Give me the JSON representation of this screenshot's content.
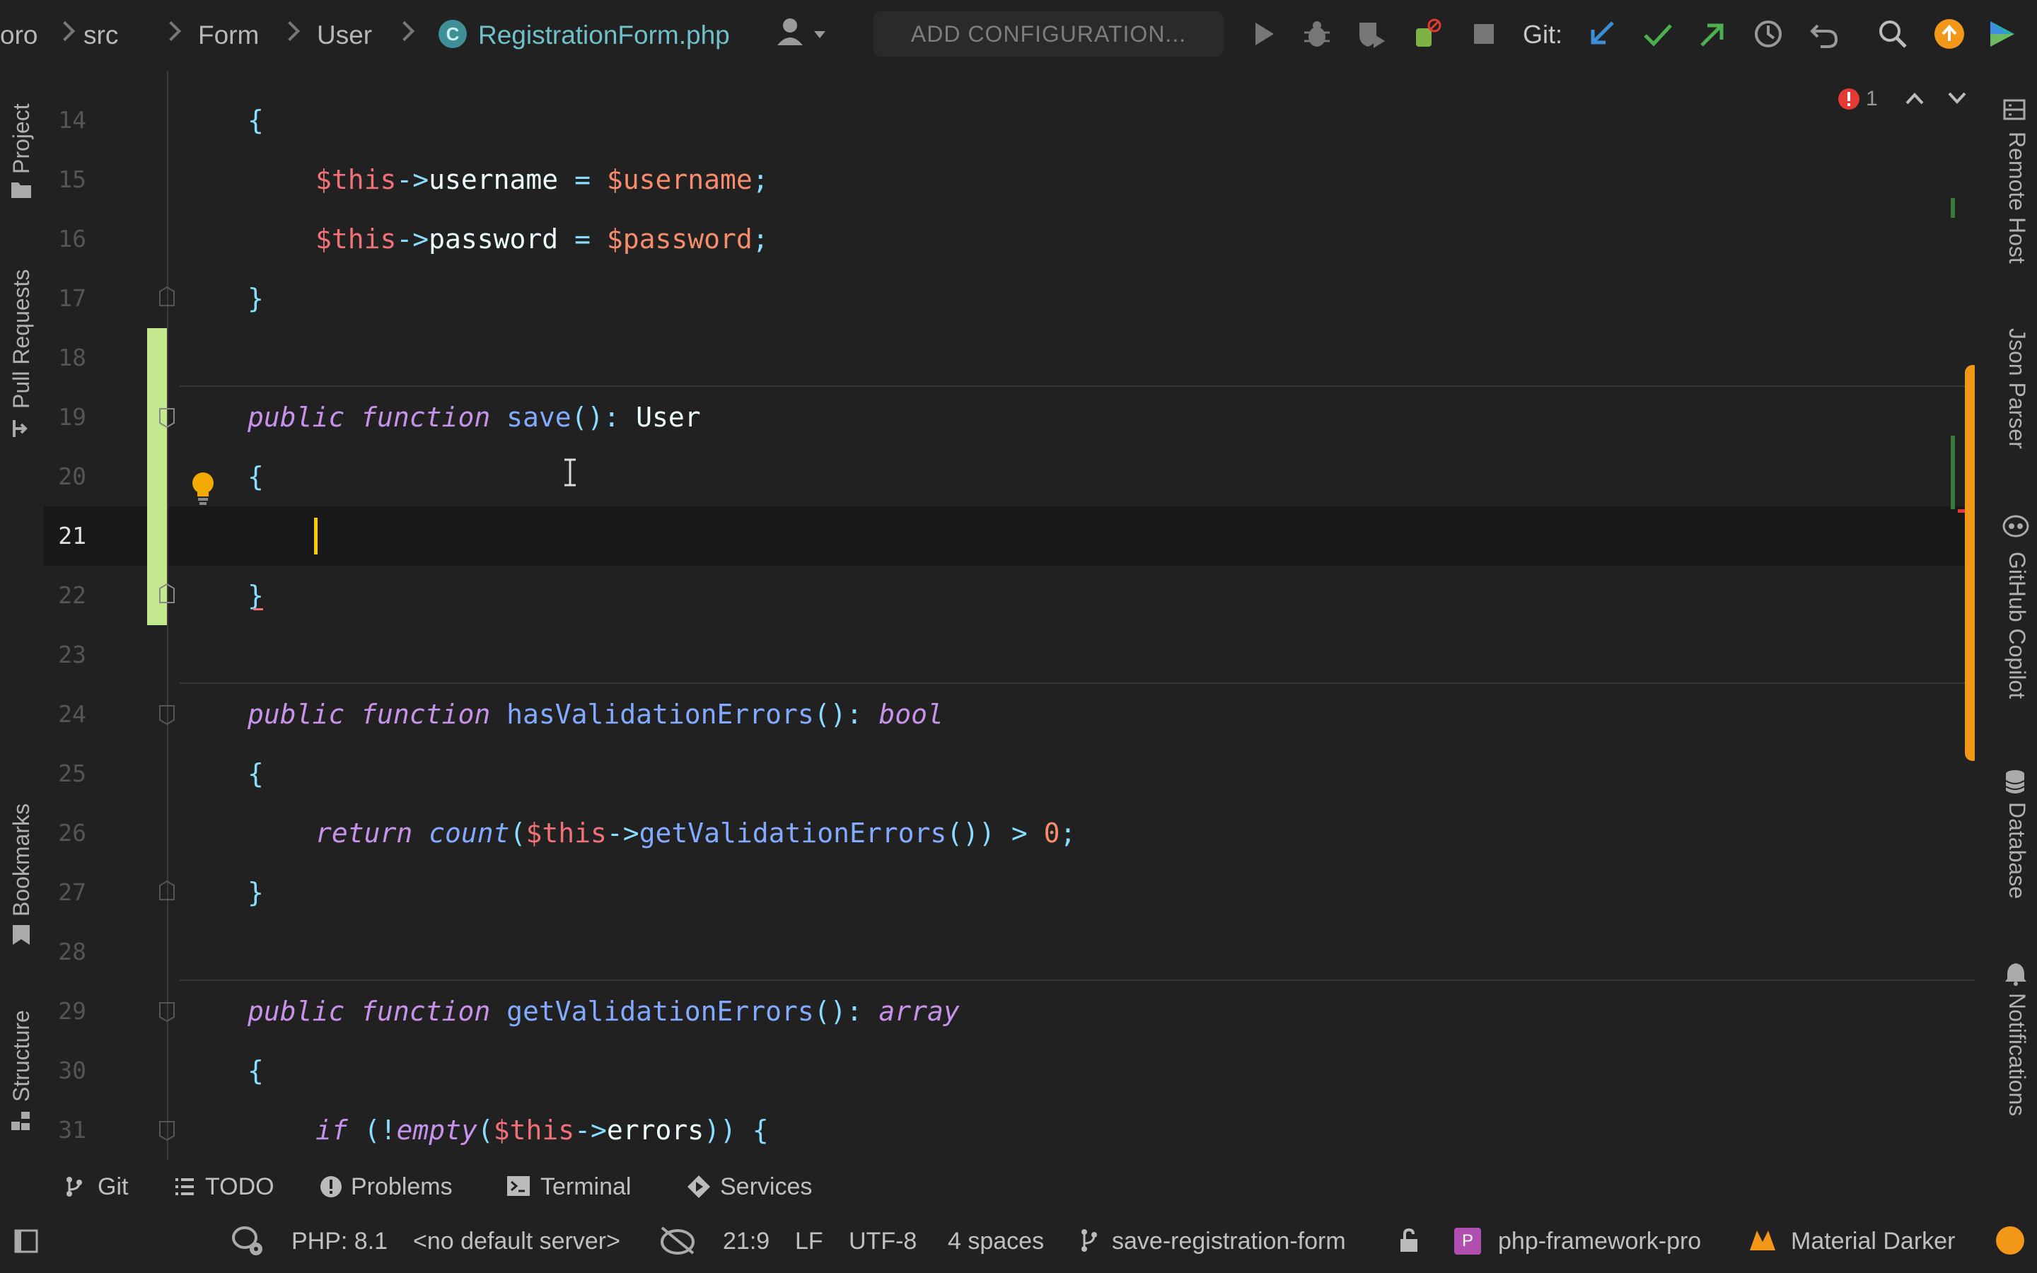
{
  "breadcrumbs": {
    "project_partial": "oro",
    "items": [
      "src",
      "Form",
      "User"
    ],
    "file": "RegistrationForm.php",
    "file_icon_letter": "C"
  },
  "toolbar": {
    "add_configuration": "ADD CONFIGURATION...",
    "git_label": "Git:",
    "icons": [
      "user-icon",
      "run-icon",
      "debug-icon",
      "coverage-icon",
      "profile-icon",
      "stop-icon",
      "git-update-icon",
      "git-commit-icon",
      "git-push-icon",
      "history-icon",
      "rollback-icon",
      "search-icon",
      "update-available-icon",
      "toolbox-icon"
    ]
  },
  "left_tools": [
    "Project",
    "Pull Requests",
    "Bookmarks",
    "Structure"
  ],
  "right_tools": [
    "Remote Host",
    "Json Parser",
    "GitHub Copilot",
    "Database",
    "Notifications"
  ],
  "inspection": {
    "error_count": "1"
  },
  "editor": {
    "current_line": 21,
    "lines": [
      {
        "n": "14"
      },
      {
        "n": "15"
      },
      {
        "n": "16"
      },
      {
        "n": "17"
      },
      {
        "n": "18"
      },
      {
        "n": "19"
      },
      {
        "n": "20"
      },
      {
        "n": "21"
      },
      {
        "n": "22"
      },
      {
        "n": "23"
      },
      {
        "n": "24"
      },
      {
        "n": "25"
      },
      {
        "n": "26"
      },
      {
        "n": "27"
      },
      {
        "n": "28"
      },
      {
        "n": "29"
      },
      {
        "n": "30"
      },
      {
        "n": "31"
      }
    ],
    "tokens": {
      "this": "$this",
      "arrow": "->",
      "username": "username",
      "username_var": "$username",
      "password": "password",
      "password_var": "$password",
      "public": "public",
      "function": "function",
      "save": "save",
      "user_type": "User",
      "hasValidationErrors": "hasValidationErrors",
      "bool": "bool",
      "return": "return",
      "count": "count",
      "getValidationErrors": "getValidationErrors",
      "zero": "0",
      "array": "array",
      "if": "if",
      "empty": "empty",
      "errors": "errors"
    }
  },
  "bottom_tabs": [
    "Git",
    "TODO",
    "Problems",
    "Terminal",
    "Services"
  ],
  "status_bar": {
    "php": "PHP: 8.1",
    "server": "<no default server>",
    "position": "21:9",
    "line_sep": "LF",
    "encoding": "UTF-8",
    "indent": "4 spaces",
    "branch": "save-registration-form",
    "project_badge": "P",
    "project": "php-framework-pro",
    "theme": "Material Darker"
  },
  "colors": {
    "background": "#212121",
    "keyword": "#c792ea",
    "function": "#82aaff",
    "variable": "#f07178",
    "operator": "#89ddff",
    "number": "#f78c6c",
    "changed_gutter": "#c3e88d",
    "caret": "#ffcc00",
    "scroll_marker": "#f29718"
  }
}
